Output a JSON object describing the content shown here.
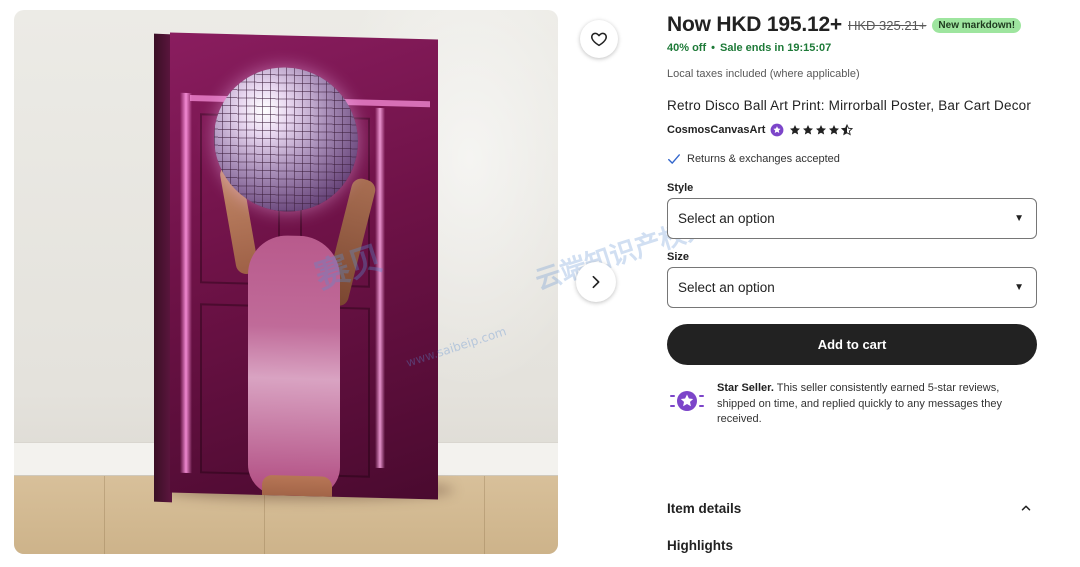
{
  "product": {
    "price_now": "Now HKD 195.12+",
    "price_old": "HKD 325.21+",
    "markdown_badge": "New markdown!",
    "discount": "40% off",
    "separator": "•",
    "sale_ends": "Sale ends in 19:15:07",
    "taxes_note": "Local taxes included (where applicable)",
    "title": "Retro Disco Ball Art Print: Mirrorball Poster, Bar Cart Decor",
    "shop_name": "CosmosCanvasArt",
    "rating_stars": 4.5,
    "returns": "Returns & exchanges accepted"
  },
  "options": {
    "style_label": "Style",
    "style_value": "Select an option",
    "size_label": "Size",
    "size_value": "Select an option"
  },
  "actions": {
    "add_to_cart": "Add to cart"
  },
  "star_seller": {
    "title": "Star Seller.",
    "text": " This seller consistently earned 5-star reviews, shipped on time, and replied quickly to any messages they received."
  },
  "sections": {
    "item_details": "Item details",
    "highlights": "Highlights"
  },
  "watermark": {
    "brand_cn": "赛贝",
    "site": "www.saibeip.com",
    "slogan_cn": "云端知识产权大平台"
  },
  "colors": {
    "accent_sale": "#1e7a38",
    "badge_bg": "#9ee59f",
    "star_seller_purple": "#7c45c9",
    "button_dark": "#222222"
  },
  "icons": {
    "favorite": "heart-icon",
    "next_image": "chevron-right-icon",
    "shop_badge": "star-seller-badge-icon",
    "returns": "checkmark-icon",
    "dropdown": "caret-down-icon",
    "section_toggle": "chevron-up-icon"
  }
}
